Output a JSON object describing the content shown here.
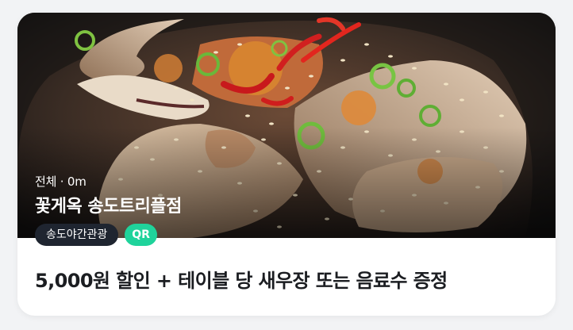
{
  "card": {
    "meta": "전체 · 0m",
    "store_name": "꽃게옥 송도트리플점",
    "tags": {
      "area": "송도야간관광",
      "qr": "QR"
    },
    "benefit": "5,000원 할인 + 테이블 당 새우장 또는 음료수 증정"
  },
  "colors": {
    "qr_badge": "#1fd39b",
    "area_badge": "#1f2530",
    "benefit_text": "#1b1d21",
    "page_bg": "#f2f3f5"
  },
  "image": {
    "subject": "spicy marinated crab dish photo"
  }
}
